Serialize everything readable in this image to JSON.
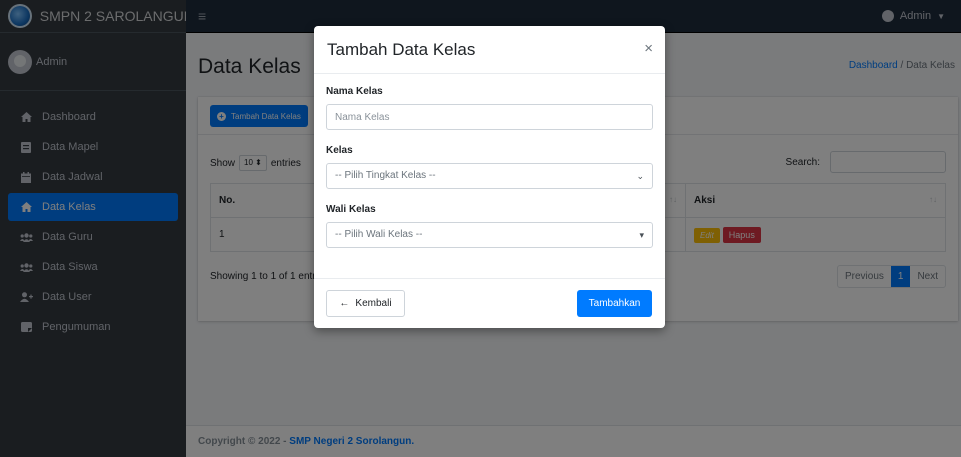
{
  "sidebar": {
    "brand": "SMPN 2 SAROLANGUN",
    "user": "Admin",
    "items": [
      {
        "label": "Dashboard",
        "icon": "house-icon"
      },
      {
        "label": "Data Mapel",
        "icon": "book-icon"
      },
      {
        "label": "Data Jadwal",
        "icon": "calendar-icon"
      },
      {
        "label": "Data Kelas",
        "icon": "house-icon",
        "active": true
      },
      {
        "label": "Data Guru",
        "icon": "users-icon"
      },
      {
        "label": "Data Siswa",
        "icon": "users-icon"
      },
      {
        "label": "Data User",
        "icon": "user-plus-icon"
      },
      {
        "label": "Pengumuman",
        "icon": "bullhorn-icon"
      }
    ]
  },
  "navbar": {
    "menu_icon": "≡",
    "user_label": "Admin"
  },
  "page": {
    "title": "Data Kelas",
    "breadcrumb_home": "Dashboard",
    "breadcrumb_sep": " / ",
    "breadcrumb_current": "Data Kelas"
  },
  "card": {
    "add_button": "Tambah Data Kelas",
    "show_prefix": "Show",
    "show_value": "10",
    "show_suffix": "entries",
    "search_label": "Search:",
    "columns": [
      "No.",
      "Aksi"
    ],
    "rows": [
      {
        "no": "1",
        "edit": "Edit",
        "delete": "Hapus"
      }
    ],
    "info": "Showing 1 to 1 of 1 entries",
    "pager": {
      "prev": "Previous",
      "current": "1",
      "next": "Next"
    }
  },
  "footer": {
    "prefix": "Copyright © 2022 - ",
    "link": "SMP Negeri 2 Sorolangun."
  },
  "modal": {
    "title": "Tambah Data Kelas",
    "close": "×",
    "fields": {
      "nama_label": "Nama Kelas",
      "nama_placeholder": "Nama Kelas",
      "kelas_label": "Kelas",
      "kelas_value": "-- Pilih Tingkat Kelas --",
      "wali_label": "Wali Kelas",
      "wali_value": "-- Pilih Wali Kelas --"
    },
    "back_button": "Kembali",
    "submit_button": "Tambahkan"
  },
  "colors": {
    "primary": "#007bff",
    "sidebar_bg": "#343a40",
    "navbar_bg": "#1f2d3d",
    "warning": "#ffc107",
    "danger": "#dc3545"
  }
}
